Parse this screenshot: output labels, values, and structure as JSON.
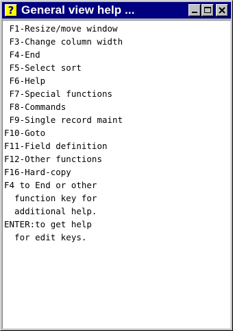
{
  "window": {
    "title": "General view help  ...",
    "icon": "help-question-icon",
    "buttons": [
      "minimize-icon",
      "maximize-icon",
      "close-icon"
    ]
  },
  "help": {
    "lines": [
      " F1-Resize/move window",
      " F3-Change column width",
      " F4-End",
      " F5-Select sort",
      " F6-Help",
      " F7-Special functions",
      " F8-Commands",
      " F9-Single record maint",
      "F10-Goto",
      "F11-Field definition",
      "F12-Other functions",
      "F16-Hard-copy",
      "F4 to End or other",
      "  function key for",
      "  additional help.",
      "ENTER:to get help",
      "  for edit keys."
    ]
  },
  "colors": {
    "titlebar": "#000080",
    "title_text": "#ffffff",
    "frame": "#c0c0c0",
    "client_bg": "#ffffff",
    "icon_bg": "#ffff00"
  }
}
